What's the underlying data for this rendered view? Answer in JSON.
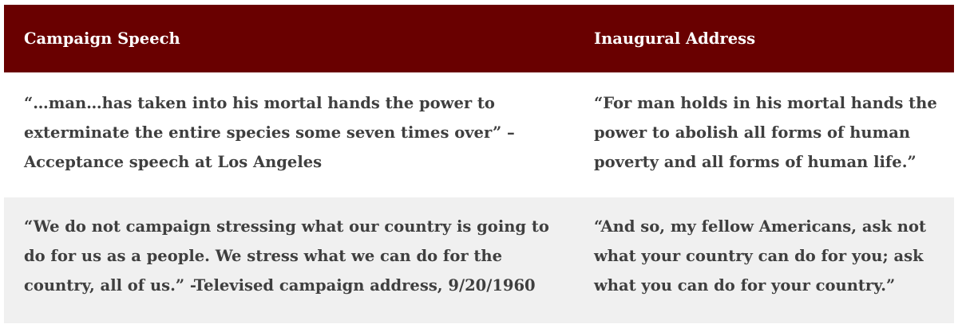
{
  "table": {
    "headers": [
      "Campaign Speech",
      "Inaugural Address"
    ],
    "rows": [
      [
        "“…man…has taken into his mortal hands the power to exterminate the entire species some seven times over” – Acceptance speech at Los Angeles",
        "“For man holds in his mortal hands the power to abolish all forms of human poverty and all forms of human life.”"
      ],
      [
        "“We do not campaign stressing what our country is going to do for us as a people. We stress what we can do for the country, all of us.” -Televised campaign address, 9/20/1960",
        "“And so, my fellow Americans, ask not what your country can do for you; ask what you can do for your country.”"
      ]
    ]
  },
  "colors": {
    "header_background": "#690000",
    "header_text": "#ffffff",
    "body_text": "#3f3f3f",
    "row_alt_background": "#f0f0f0"
  }
}
